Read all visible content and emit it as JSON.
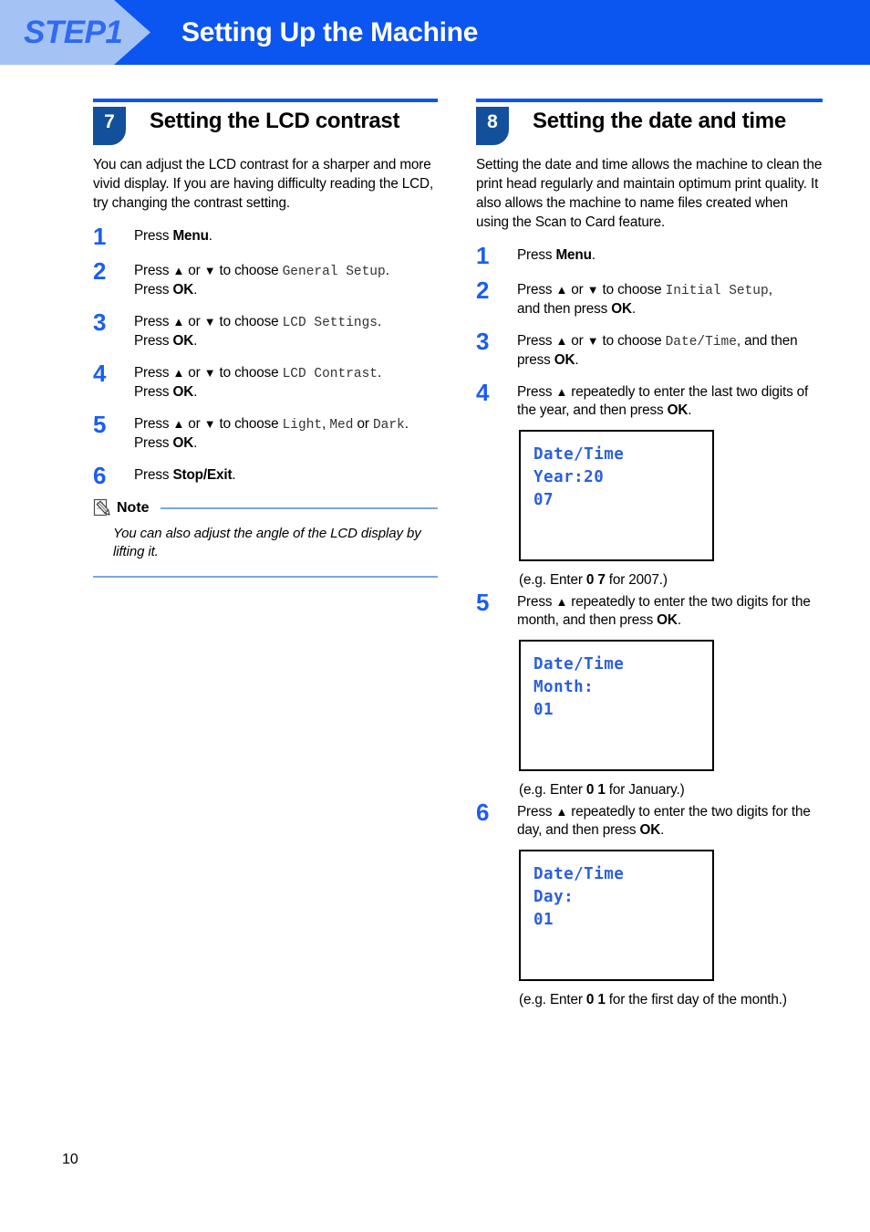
{
  "banner": {
    "step_label": "STEP1",
    "title": "Setting Up the Machine",
    "bg_color": "#0b55f0",
    "arrow_color": "#a5c2f5",
    "step_text_color": "#2f6bf0"
  },
  "colors": {
    "accent_blue": "#0b55f0",
    "badge_blue": "#12509c",
    "step_number_blue": "#1a5ef0",
    "lcd_blue": "#2a5fe0",
    "note_rule_blue": "#7ba7dd"
  },
  "left_section": {
    "number": "7",
    "title": "Setting the LCD contrast",
    "intro": "You can adjust the LCD contrast for a sharper and more vivid display. If you are having difficulty reading the LCD, try changing the contrast setting.",
    "steps": [
      {
        "number": "1",
        "html": "Press <span class=\"b\">Menu</span>."
      },
      {
        "number": "2",
        "html": "Press <span class=\"tri\">&#9650;</span> or <span class=\"tri\">&#9660;</span> to choose <span class=\"mono\">General Setup</span>.<br>Press <span class=\"b\">OK</span>."
      },
      {
        "number": "3",
        "html": "Press <span class=\"tri\">&#9650;</span> or <span class=\"tri\">&#9660;</span> to choose <span class=\"mono\">LCD Settings</span>.<br>Press <span class=\"b\">OK</span>."
      },
      {
        "number": "4",
        "html": "Press <span class=\"tri\">&#9650;</span> or <span class=\"tri\">&#9660;</span> to choose <span class=\"mono\">LCD Contrast</span>.<br>Press <span class=\"b\">OK</span>."
      },
      {
        "number": "5",
        "html": "Press <span class=\"tri\">&#9650;</span> or <span class=\"tri\">&#9660;</span> to choose <span class=\"mono\">Light</span>, <span class=\"mono\">Med</span> or <span class=\"mono\">Dark</span>.<br>Press <span class=\"b\">OK</span>."
      },
      {
        "number": "6",
        "html": "Press <span class=\"b\">Stop/Exit</span>."
      }
    ],
    "note": {
      "label": "Note",
      "icon": "note-pencil-icon",
      "text": "You can also adjust the angle of the LCD display by lifting it."
    }
  },
  "right_section": {
    "number": "8",
    "title": "Setting the date and time",
    "intro": "Setting the date and time allows the machine to clean the print head regularly and maintain optimum print quality. It also allows the machine to name files created when using the Scan to Card feature.",
    "steps": [
      {
        "number": "1",
        "html": "Press <span class=\"b\">Menu</span>."
      },
      {
        "number": "2",
        "html": "Press <span class=\"tri\">&#9650;</span> or <span class=\"tri\">&#9660;</span> to choose <span class=\"mono\">Initial Setup</span>,<br>and then press <span class=\"b\">OK</span>."
      },
      {
        "number": "3",
        "html": "Press <span class=\"tri\">&#9650;</span> or <span class=\"tri\">&#9660;</span> to choose <span class=\"mono\">Date/Time</span>, and then press <span class=\"b\">OK</span>."
      },
      {
        "number": "4",
        "html": "Press <span class=\"tri\">&#9650;</span> repeatedly to enter the last two digits of the year, and then press <span class=\"b\">OK</span>."
      },
      {
        "number": "5",
        "html": "Press <span class=\"tri\">&#9650;</span> repeatedly to enter the two digits for the month, and then press <span class=\"b\">OK</span>."
      },
      {
        "number": "6",
        "html": "Press <span class=\"tri\">&#9650;</span> repeatedly to enter the two digits for the day, and then press <span class=\"b\">OK</span>."
      }
    ],
    "lcd_panels": [
      {
        "lines": [
          "Date/Time",
          "Year:20",
          "07"
        ]
      },
      {
        "lines": [
          "Date/Time",
          "Month:",
          "01"
        ]
      },
      {
        "lines": [
          "Date/Time",
          "Day:",
          "01"
        ]
      }
    ],
    "examples": [
      "(e.g. Enter <span class=\"b\">0 7</span> for 2007.)",
      "(e.g. Enter <span class=\"b\">0 1</span> for January.)",
      "(e.g. Enter <span class=\"b\">0 1</span> for the first day of the month.)"
    ]
  },
  "footer": {
    "page_number": "10"
  }
}
